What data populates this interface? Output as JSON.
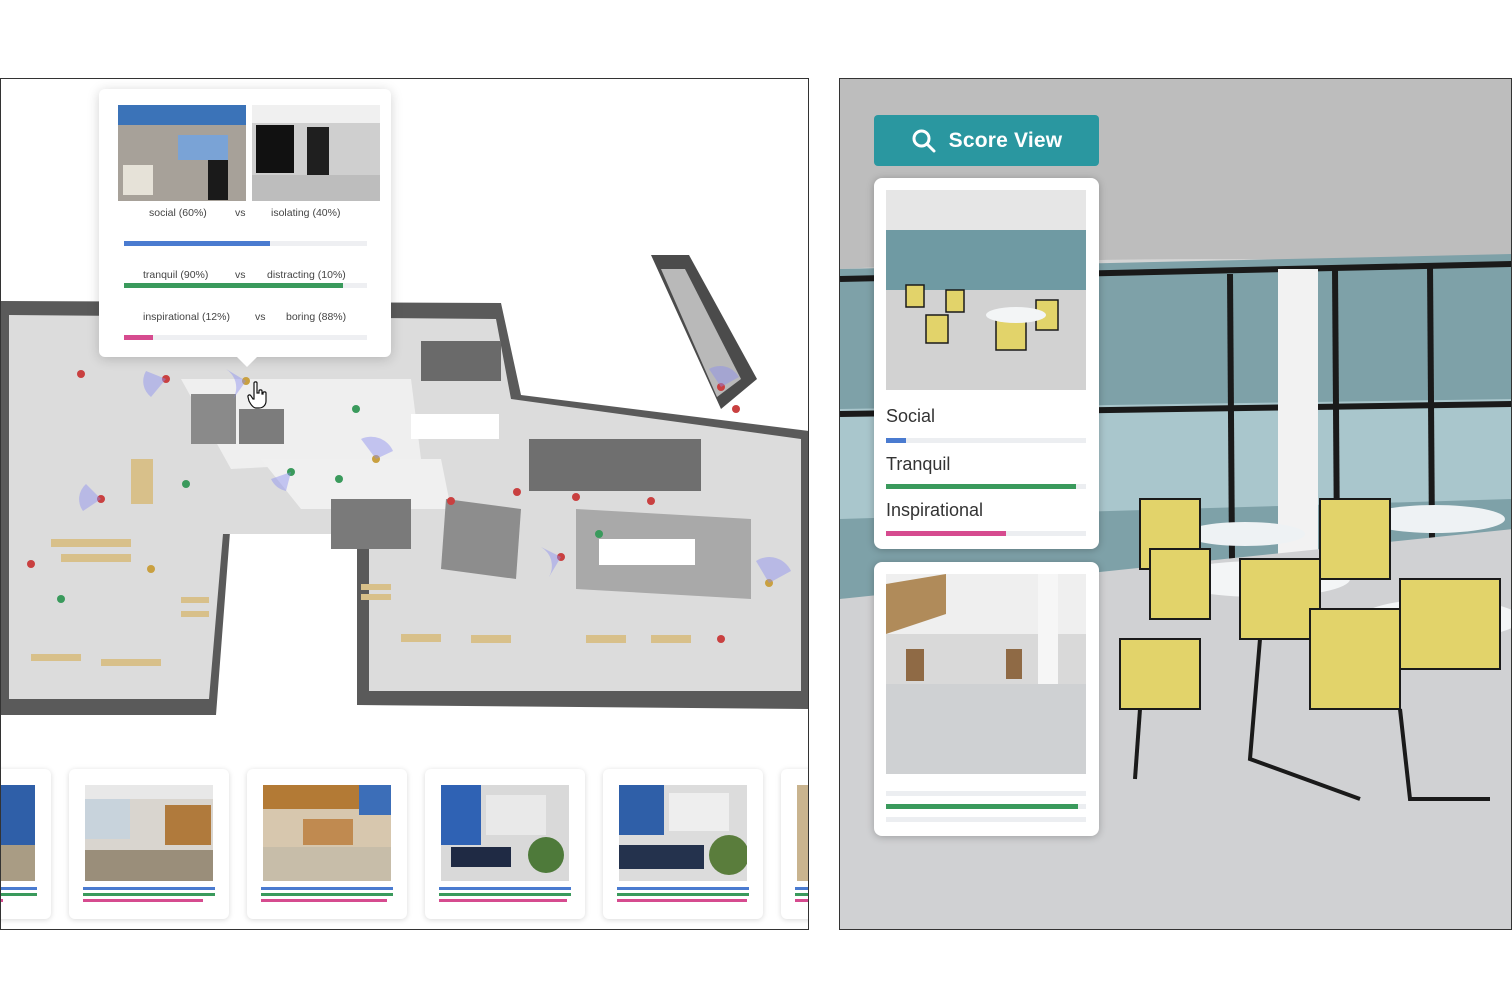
{
  "tooltip": {
    "rows": [
      {
        "left": "social (60%)",
        "vs": "vs",
        "right": "isolating (40%)",
        "value": 0.6,
        "color": "#4a7bd0"
      },
      {
        "left": "tranquil (90%)",
        "vs": "vs",
        "right": "distracting (10%)",
        "value": 0.9,
        "color": "#3a9a5c"
      },
      {
        "left": "inspirational (12%)",
        "vs": "vs",
        "right": "boring (88%)",
        "value": 0.12,
        "color": "#d64b8f"
      }
    ]
  },
  "icons": {
    "cursor": "hand-pointer-icon",
    "search": "search-icon"
  },
  "score_view": {
    "button_label": "Score View",
    "button_color": "#2a97a0",
    "cards": [
      {
        "metrics": [
          {
            "label": "Social",
            "value": 0.1,
            "color": "#4a7bd0"
          },
          {
            "label": "Tranquil",
            "value": 0.95,
            "color": "#3a9a5c"
          },
          {
            "label": "Inspirational",
            "value": 0.6,
            "color": "#d64b8f"
          }
        ]
      },
      {
        "metrics": [
          {
            "label": "",
            "value": 0.0,
            "color": "#4a7bd0"
          },
          {
            "label": "",
            "value": 0.96,
            "color": "#3a9a5c"
          },
          {
            "label": "",
            "value": 0.0,
            "color": "#d64b8f"
          }
        ]
      }
    ]
  },
  "colors": {
    "social": "#4a7bd0",
    "tranquil": "#3a9a5c",
    "inspirational": "#d64b8f",
    "accent": "#2a97a0"
  }
}
